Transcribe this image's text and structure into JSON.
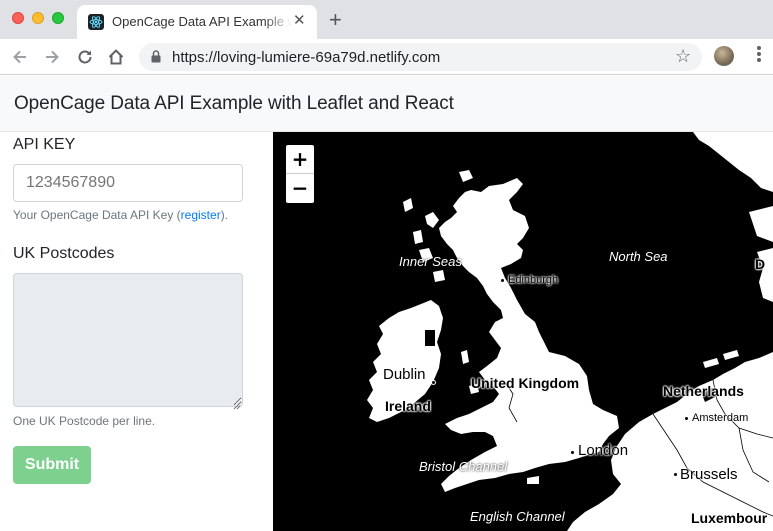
{
  "browser": {
    "tab_title": "OpenCage Data API Example with Leaflet and React",
    "tab_close": "✕",
    "new_tab": "+",
    "url": "https://loving-lumiere-69a79d.netlify.com",
    "star": "☆"
  },
  "page": {
    "title": "OpenCage Data API Example with Leaflet and React"
  },
  "form": {
    "api_key_label": "API KEY",
    "api_key_placeholder": "1234567890",
    "api_key_help_prefix": "Your OpenCage Data API Key (",
    "api_key_help_link": "register",
    "api_key_help_suffix": ").",
    "postcodes_label": "UK Postcodes",
    "postcodes_value": "",
    "postcodes_help": "One UK Postcode per line.",
    "submit_label": "Submit"
  },
  "map": {
    "zoom_in": "+",
    "zoom_out": "−",
    "labels": {
      "inner_seas": "Inner Seas",
      "north_sea": "North Sea",
      "edinburgh": "Edinburgh",
      "dublin": "Dublin",
      "ireland": "Ireland",
      "united_kingdom": "United Kingdom",
      "netherlands": "Netherlands",
      "amsterdam": "Amsterdam",
      "london": "London",
      "bristol_channel": "Bristol Channel",
      "brussels": "Brussels",
      "english_channel": "English Channel",
      "luxembourg": "Luxembour",
      "edge_letter": "D"
    }
  }
}
